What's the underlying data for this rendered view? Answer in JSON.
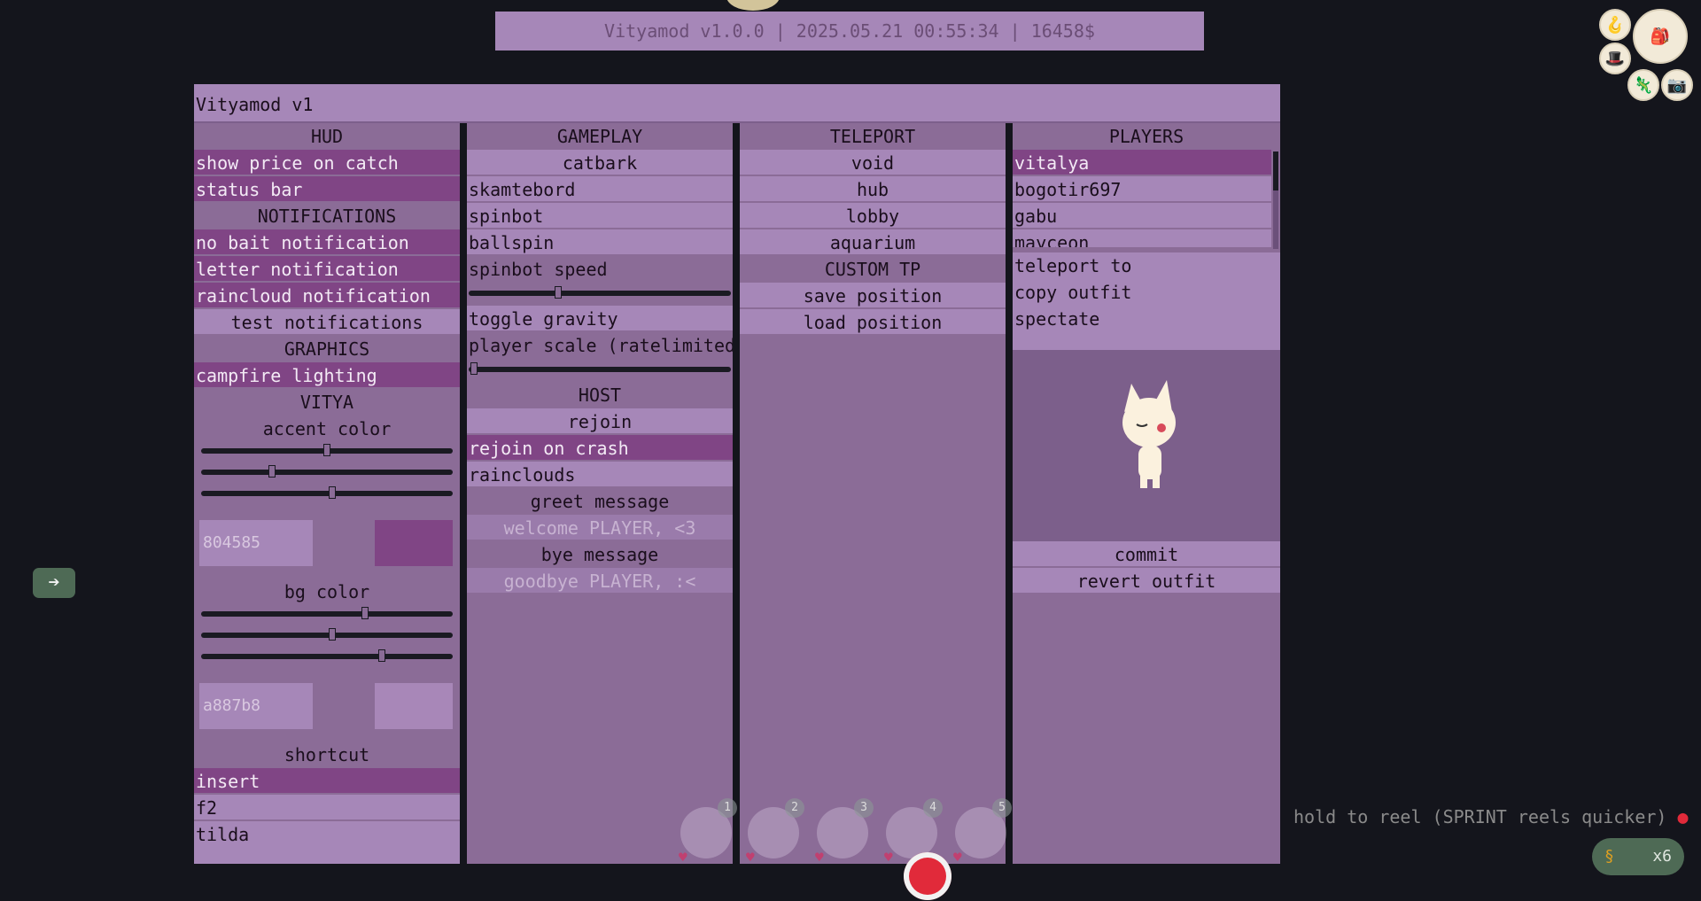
{
  "status_bar": {
    "text": "Vityamod v1.0.0 | 2025.05.21 00:55:34 | 16458$"
  },
  "window": {
    "title": "Vityamod v1"
  },
  "hud": {
    "header": "HUD",
    "show_price": "show price on catch",
    "status_bar": "status bar",
    "notifications_header": "NOTIFICATIONS",
    "no_bait": "no bait notification",
    "letter": "letter notification",
    "raincloud": "raincloud notification",
    "test": "test notifications",
    "graphics_header": "GRAPHICS",
    "campfire": "campfire lighting",
    "vitya_header": "VITYA",
    "accent_label": "accent color",
    "accent_sliders": [
      0.5,
      0.28,
      0.52
    ],
    "accent_hex": "804585",
    "accent_color": "#804585",
    "bg_label": "bg color",
    "bg_sliders": [
      0.65,
      0.52,
      0.72
    ],
    "bg_hex": "a887b8",
    "bg_color": "#a887b8",
    "shortcut_label": "shortcut",
    "shortcuts": [
      "insert",
      "f2",
      "tilda"
    ]
  },
  "gameplay": {
    "header": "GAMEPLAY",
    "catbark": "catbark",
    "skamtebord": "skamtebord",
    "spinbot": "spinbot",
    "ballspin": "ballspin",
    "spinbot_speed_label": "spinbot speed",
    "spinbot_speed": 0.34,
    "toggle_gravity": "toggle gravity",
    "player_scale_label": "player scale (ratelimited)",
    "player_scale": 0.02,
    "host_header": "HOST",
    "rejoin": "rejoin",
    "rejoin_on_crash": "rejoin on crash",
    "rainclouds": "rainclouds",
    "greet_label": "greet message",
    "greet_placeholder": "welcome PLAYER, <3",
    "bye_label": "bye message",
    "bye_placeholder": "goodbye PLAYER, :<"
  },
  "teleport": {
    "header": "TELEPORT",
    "void": "void",
    "hub": "hub",
    "lobby": "lobby",
    "aquarium": "aquarium",
    "custom_header": "CUSTOM TP",
    "save": "save position",
    "load": "load position"
  },
  "players": {
    "header": "PLAYERS",
    "list": [
      "vitalya",
      "bogotir697",
      "gabu",
      "mayceon"
    ],
    "teleport_to": "teleport to",
    "copy_outfit": "copy outfit",
    "spectate": "spectate",
    "commit": "commit",
    "revert_outfit": "revert outfit"
  },
  "game_hud": {
    "hint": "hold to reel (SPRINT reels quicker)",
    "bait_count": "x6",
    "hotbar_slots": [
      "1",
      "2",
      "3",
      "4",
      "5"
    ]
  },
  "colors": {
    "panel": "#8b6c97",
    "button": "#a687b8",
    "active": "#804585"
  }
}
